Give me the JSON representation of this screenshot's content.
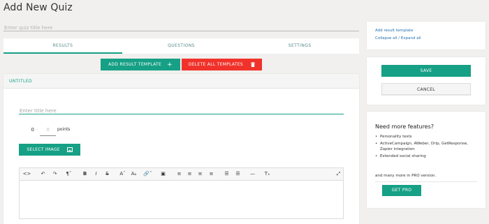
{
  "page": {
    "title": "Add New Quiz"
  },
  "quiz_title": {
    "placeholder": "Enter quiz title here",
    "value": ""
  },
  "tabs": [
    {
      "label": "RESULTS",
      "active": true
    },
    {
      "label": "QUESTIONS",
      "active": false
    },
    {
      "label": "SETTINGS",
      "active": false
    }
  ],
  "actions": {
    "add_template": {
      "label": "ADD RESULT TEMPLATE",
      "icon": "plus-icon"
    },
    "delete_templates": {
      "label": "DELETE ALL TEMPLATES",
      "icon": "trash-icon"
    }
  },
  "result": {
    "header": "UNTITLED",
    "title_placeholder": "Enter title here",
    "min": "0",
    "separator": "-",
    "max_placeholder": "X",
    "points_label": "points",
    "select_image": {
      "label": "SELECT IMAGE",
      "icon": "image-icon"
    }
  },
  "editor": {
    "toolbar": [
      {
        "name": "source-code-icon",
        "glyph": "<>"
      },
      {
        "name": "undo-icon",
        "glyph": "↶"
      },
      {
        "name": "redo-icon",
        "glyph": "↷"
      },
      {
        "name": "paragraph-format-icon",
        "glyph": "¶ˇ"
      },
      {
        "name": "bold-icon",
        "glyph": "B"
      },
      {
        "name": "italic-icon",
        "glyph": "I"
      },
      {
        "name": "strikethrough-icon",
        "glyph": "S"
      },
      {
        "name": "font-size-increase-icon",
        "glyph": "Aˇ"
      },
      {
        "name": "font-size-decrease-icon",
        "glyph": "Aₐ"
      },
      {
        "name": "link-icon",
        "glyph": "🔗ˇ"
      },
      {
        "name": "image-icon",
        "glyph": "▣"
      },
      {
        "name": "align-left-icon",
        "glyph": "≡"
      },
      {
        "name": "align-center-icon",
        "glyph": "≡"
      },
      {
        "name": "align-right-icon",
        "glyph": "≡"
      },
      {
        "name": "align-justify-icon",
        "glyph": "≡"
      },
      {
        "name": "bulleted-list-icon",
        "glyph": "☰"
      },
      {
        "name": "numbered-list-icon",
        "glyph": "☰"
      },
      {
        "name": "horizontal-line-icon",
        "glyph": "—"
      },
      {
        "name": "clear-formatting-icon",
        "glyph": "Tₓ"
      },
      {
        "name": "fullscreen-icon",
        "glyph": "⤢"
      }
    ]
  },
  "sidebar": {
    "links": [
      "Add result template",
      "Collapse all / Expand all"
    ],
    "save_label": "SAVE",
    "cancel_label": "CANCEL",
    "pro": {
      "title": "Need more features?",
      "bullet": "•",
      "items": [
        "Personality tests",
        "ActiveCampaign, AWeber, Drip, GetResponse, Zapier integration",
        "Extended social sharing"
      ],
      "more": "and many more in PRO version.",
      "button": "GET PRO"
    }
  },
  "colors": {
    "accent": "#16a085",
    "danger": "#f0322b",
    "link": "#2271b1",
    "background": "#f1f0ee"
  }
}
